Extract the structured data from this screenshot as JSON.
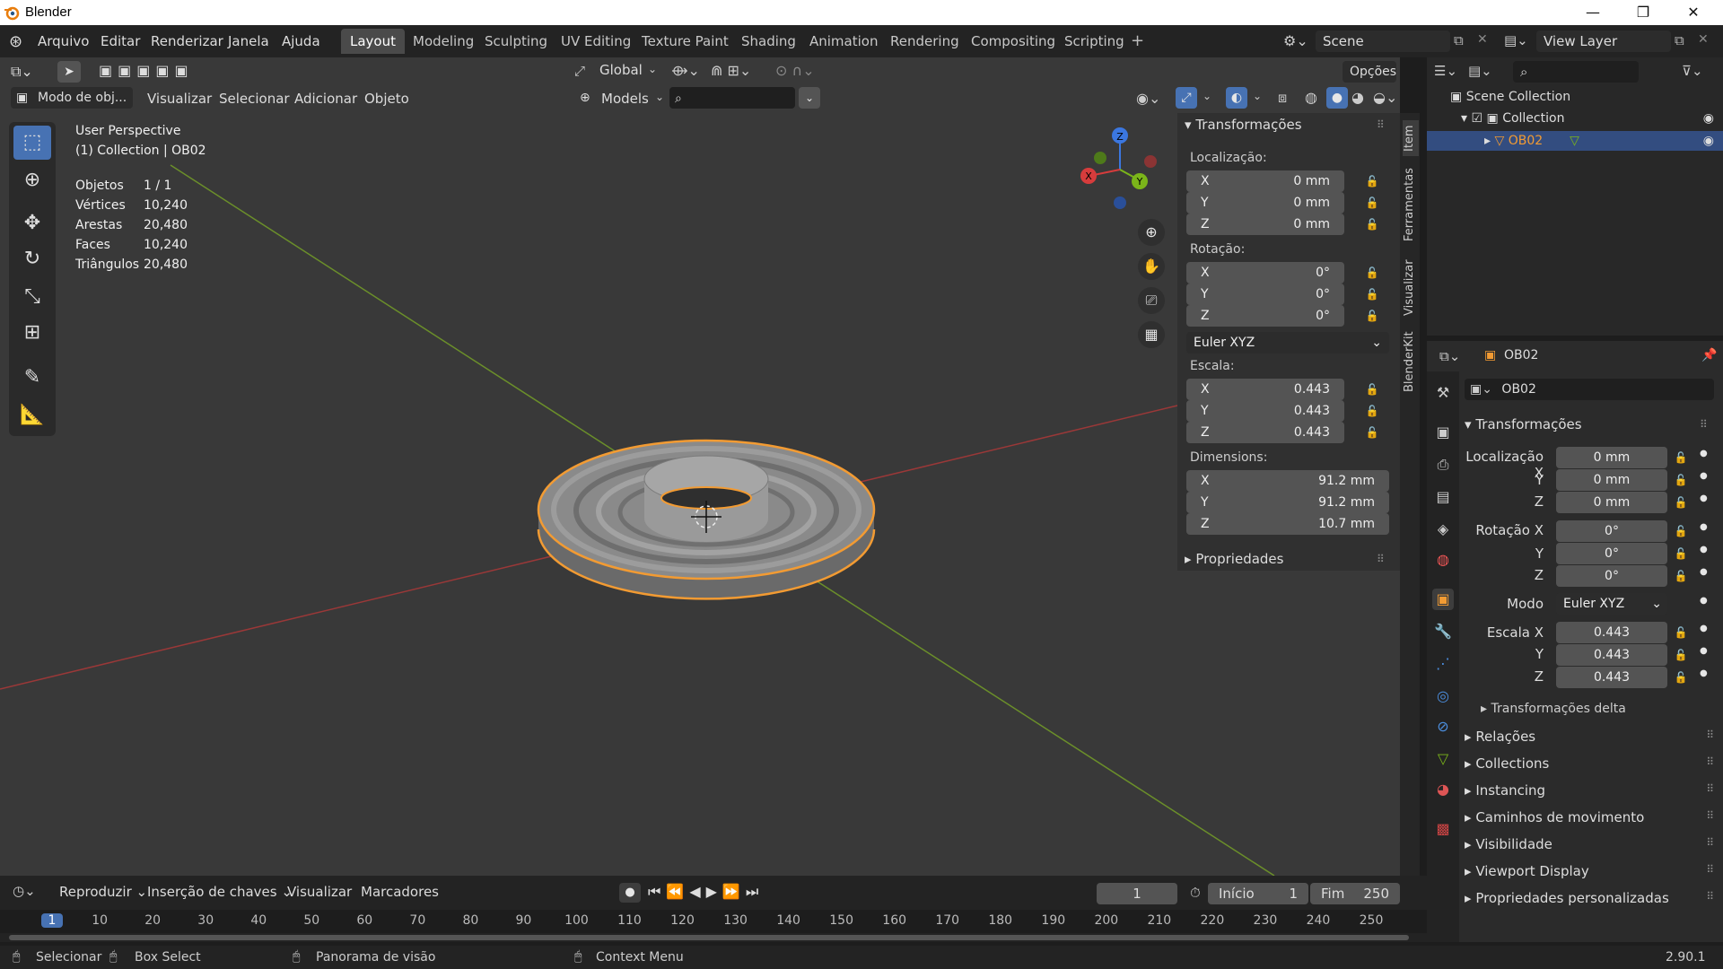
{
  "app": {
    "title": "Blender",
    "version": "2.90.1"
  },
  "menu": [
    "Arquivo",
    "Editar",
    "Renderizar",
    "Janela",
    "Ajuda"
  ],
  "workspaces": [
    "Layout",
    "Modeling",
    "Sculpting",
    "UV Editing",
    "Texture Paint",
    "Shading",
    "Animation",
    "Rendering",
    "Compositing",
    "Scripting"
  ],
  "active_workspace": "Layout",
  "scene": {
    "name": "Scene",
    "view_layer": "View Layer"
  },
  "viewport_header": {
    "orientation": "Global",
    "options_label": "Opções",
    "mode": "Modo de obj...",
    "menus": [
      "Visualizar",
      "Selecionar",
      "Adicionar",
      "Objeto"
    ],
    "collection_filter": "Models"
  },
  "overlay": {
    "view_name": "User Perspective",
    "collection_path": "(1) Collection | OB02",
    "stats": [
      {
        "label": "Objetos",
        "value": "1 / 1"
      },
      {
        "label": "Vértices",
        "value": "10,240"
      },
      {
        "label": "Arestas",
        "value": "20,480"
      },
      {
        "label": "Faces",
        "value": "10,240"
      },
      {
        "label": "Triângulos",
        "value": "20,480"
      }
    ]
  },
  "gizmo": {
    "x": "X",
    "y": "Y",
    "z": "Z"
  },
  "npanel": {
    "section": "Transformações",
    "location_label": "Localização:",
    "location": [
      {
        "axis": "X",
        "value": "0 mm"
      },
      {
        "axis": "Y",
        "value": "0 mm"
      },
      {
        "axis": "Z",
        "value": "0 mm"
      }
    ],
    "rotation_label": "Rotação:",
    "rotation": [
      {
        "axis": "X",
        "value": "0°"
      },
      {
        "axis": "Y",
        "value": "0°"
      },
      {
        "axis": "Z",
        "value": "0°"
      }
    ],
    "rotation_mode": "Euler XYZ",
    "scale_label": "Escala:",
    "scale": [
      {
        "axis": "X",
        "value": "0.443"
      },
      {
        "axis": "Y",
        "value": "0.443"
      },
      {
        "axis": "Z",
        "value": "0.443"
      }
    ],
    "dimensions_label": "Dimensions:",
    "dimensions": [
      {
        "axis": "X",
        "value": "91.2 mm"
      },
      {
        "axis": "Y",
        "value": "91.2 mm"
      },
      {
        "axis": "Z",
        "value": "10.7 mm"
      }
    ],
    "properties_section": "Propriedades",
    "tabs": [
      "Item",
      "Ferramentas",
      "Visualizar",
      "BlenderKit"
    ]
  },
  "outliner": {
    "root": "Scene Collection",
    "collection": "Collection",
    "object": "OB02"
  },
  "properties": {
    "object_name": "OB02",
    "data_name": "OB02",
    "section": "Transformações",
    "location_label": "Localização X",
    "location": [
      "0 mm",
      "0 mm",
      "0 mm"
    ],
    "rotation_label": "Rotação X",
    "rotation": [
      "0°",
      "0°",
      "0°"
    ],
    "mode_label": "Modo",
    "mode_value": "Euler XYZ",
    "scale_label": "Escala X",
    "scale": [
      "0.443",
      "0.443",
      "0.443"
    ],
    "axis_y": "Y",
    "axis_z": "Z",
    "delta": "Transformações delta",
    "collapsed": [
      "Relações",
      "Collections",
      "Instancing",
      "Caminhos de movimento",
      "Visibilidade",
      "Viewport Display",
      "Propriedades personalizadas"
    ]
  },
  "timeline": {
    "menus": [
      "Reproduzir",
      "Inserção de chaves",
      "Visualizar",
      "Marcadores"
    ],
    "current_frame": "1",
    "start_label": "Início",
    "start": "1",
    "end_label": "Fim",
    "end": "250",
    "ticks": [
      "1",
      "10",
      "20",
      "30",
      "40",
      "50",
      "60",
      "70",
      "80",
      "90",
      "100",
      "110",
      "120",
      "130",
      "140",
      "150",
      "160",
      "170",
      "180",
      "190",
      "200",
      "210",
      "220",
      "230",
      "240",
      "250"
    ]
  },
  "statusbar": {
    "items": [
      "Selecionar",
      "Box Select",
      "Panorama de visão",
      "Context Menu"
    ]
  },
  "colors": {
    "accent": "#4772b3",
    "selected": "#f29b33",
    "x_axis": "#d63c3c",
    "y_axis": "#7bb51a",
    "z_axis": "#3b77e0"
  }
}
